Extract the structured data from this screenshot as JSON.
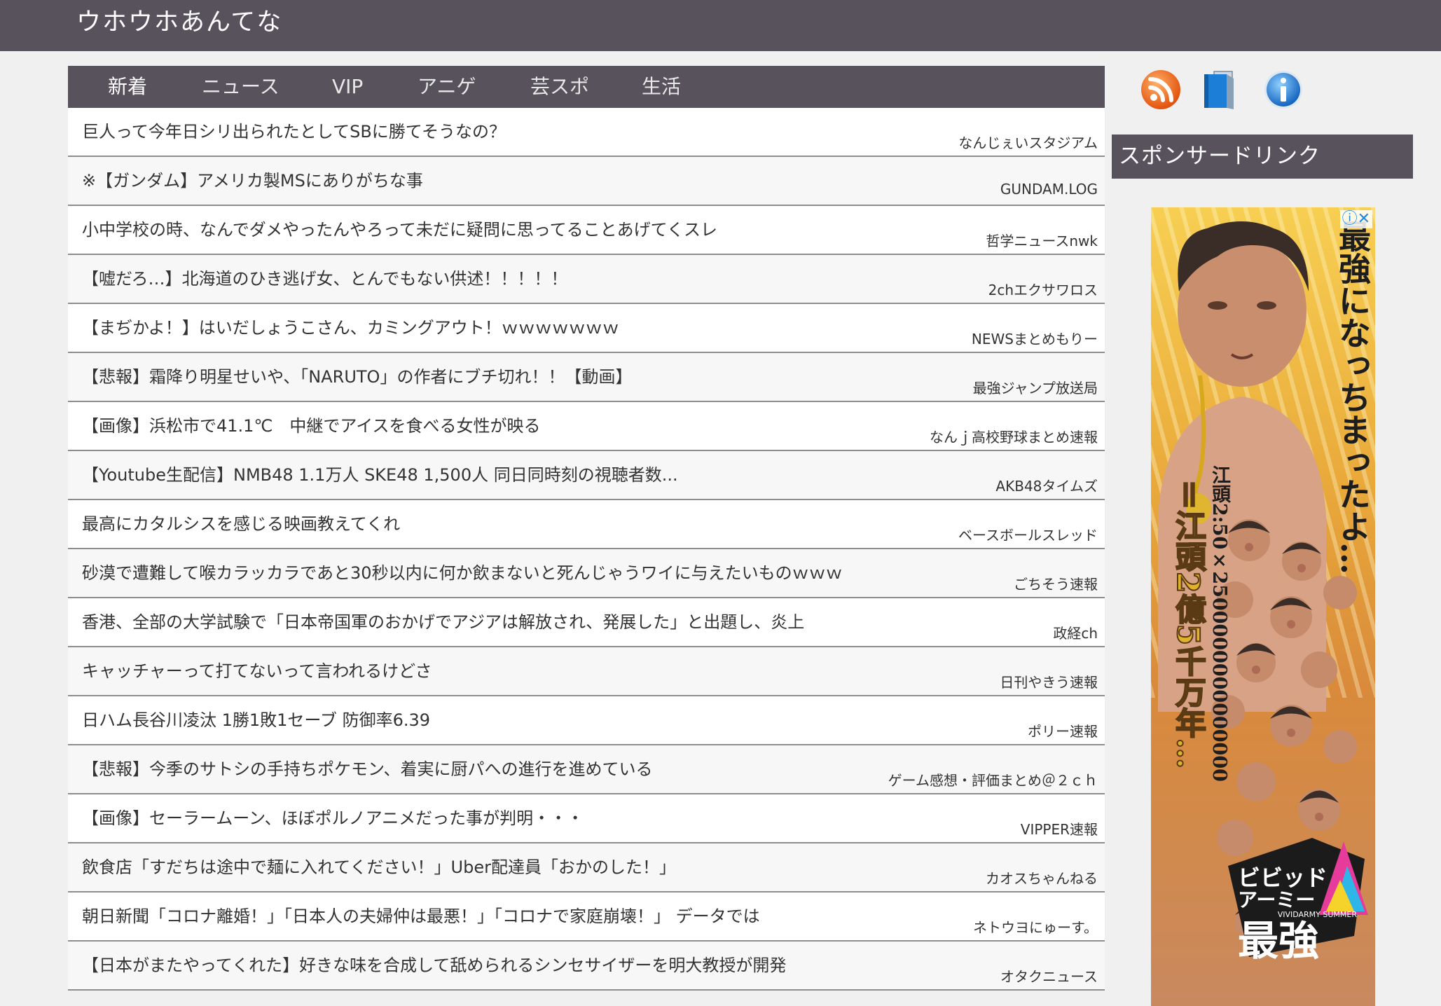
{
  "header": {
    "site_title": "ウホウホあんてな"
  },
  "tabs": [
    {
      "label": "新着",
      "active": true
    },
    {
      "label": "ニュース",
      "active": false
    },
    {
      "label": "VIP",
      "active": false
    },
    {
      "label": "アニゲ",
      "active": false
    },
    {
      "label": "芸スポ",
      "active": false
    },
    {
      "label": "生活",
      "active": false
    }
  ],
  "articles": [
    {
      "title": "巨人って今年日シリ出られたとしてSBに勝てそうなの？",
      "source": "なんじぇいスタジアム"
    },
    {
      "title": "※【ガンダム】アメリカ製MSにありがちな事",
      "source": "GUNDAM.LOG"
    },
    {
      "title": "小中学校の時、なんでダメやったんやろって未だに疑問に思ってることあげてくスレ",
      "source": "哲学ニュースnwk"
    },
    {
      "title": "【嘘だろ…】北海道のひき逃げ女、とんでもない供述！！！！！",
      "source": "2chエクサワロス"
    },
    {
      "title": "【まぢかよ！】はいだしょうこさん、カミングアウト！ｗｗｗｗｗｗｗ",
      "source": "NEWSまとめもりー"
    },
    {
      "title": "【悲報】霜降り明星せいや、「NARUTO」の作者にブチ切れ！！【動画】",
      "source": "最強ジャンプ放送局"
    },
    {
      "title": "【画像】浜松市で41.1℃　中継でアイスを食べる女性が映る",
      "source": "なんｊ高校野球まとめ速報"
    },
    {
      "title": "【Youtube生配信】NMB48 1.1万人 SKE48 1,500人 同日同時刻の視聴者数...",
      "source": "AKB48タイムズ"
    },
    {
      "title": "最高にカタルシスを感じる映画教えてくれ",
      "source": "ベースボールスレッド"
    },
    {
      "title": "砂漠で遭難して喉カラッカラであと30秒以内に何か飲まないと死んじゃうワイに与えたいものｗｗｗ",
      "source": "ごちそう速報"
    },
    {
      "title": "香港、全部の大学試験で「日本帝国軍のおかげでアジアは解放され、発展した」と出題し、炎上",
      "source": "政経ch"
    },
    {
      "title": "キャッチャーって打てないって言われるけどさ",
      "source": "日刊やきう速報"
    },
    {
      "title": "日ハム長谷川凌汰 1勝1敗1セーブ 防御率6.39",
      "source": "ポリー速報"
    },
    {
      "title": "【悲報】今季のサトシの手持ちポケモン、着実に厨パへの進行を進めている",
      "source": "ゲーム感想・評価まとめ＠２ｃｈ"
    },
    {
      "title": "【画像】セーラームーン、ほぼポルノアニメだった事が判明・・・",
      "source": "VIPPER速報"
    },
    {
      "title": "飲食店「すだちは途中で麺に入れてください！」Uber配達員「おかのした！」",
      "source": "カオスちゃんねる"
    },
    {
      "title": "朝日新聞「コロナ離婚！」「日本人の夫婦仲は最悪！」「コロナで家庭崩壊！」 データでは",
      "source": "ネトウヨにゅーす。"
    },
    {
      "title": "【日本がまたやってくれた】好きな味を合成して舐められるシンセサイザーを明大教授が開発",
      "source": "オタクニュース"
    }
  ],
  "sidebar": {
    "icons": [
      "rss-icon",
      "book-icon",
      "info-icon"
    ],
    "sponsor_heading": "スポンサードリンク",
    "ad": {
      "text_main": "最強になっちまったよ…",
      "text_sub": "江頭2:50×2500000000000000",
      "text_big": "＝江頭2億5千万年…",
      "logo_line1": "ビビッド",
      "logo_line2": "アーミー",
      "logo_line3": "最強",
      "logo_tag": "VIVIDARMY SUMMER",
      "close_label": "ⓘ✕"
    }
  },
  "colors": {
    "header_bg": "#58525d",
    "page_bg": "#f0f0f0",
    "row_alt_bg": "#f7f7f7",
    "row_border": "#8d8d8d",
    "rss_orange": "#f26b1d",
    "info_blue": "#1e88e5"
  }
}
